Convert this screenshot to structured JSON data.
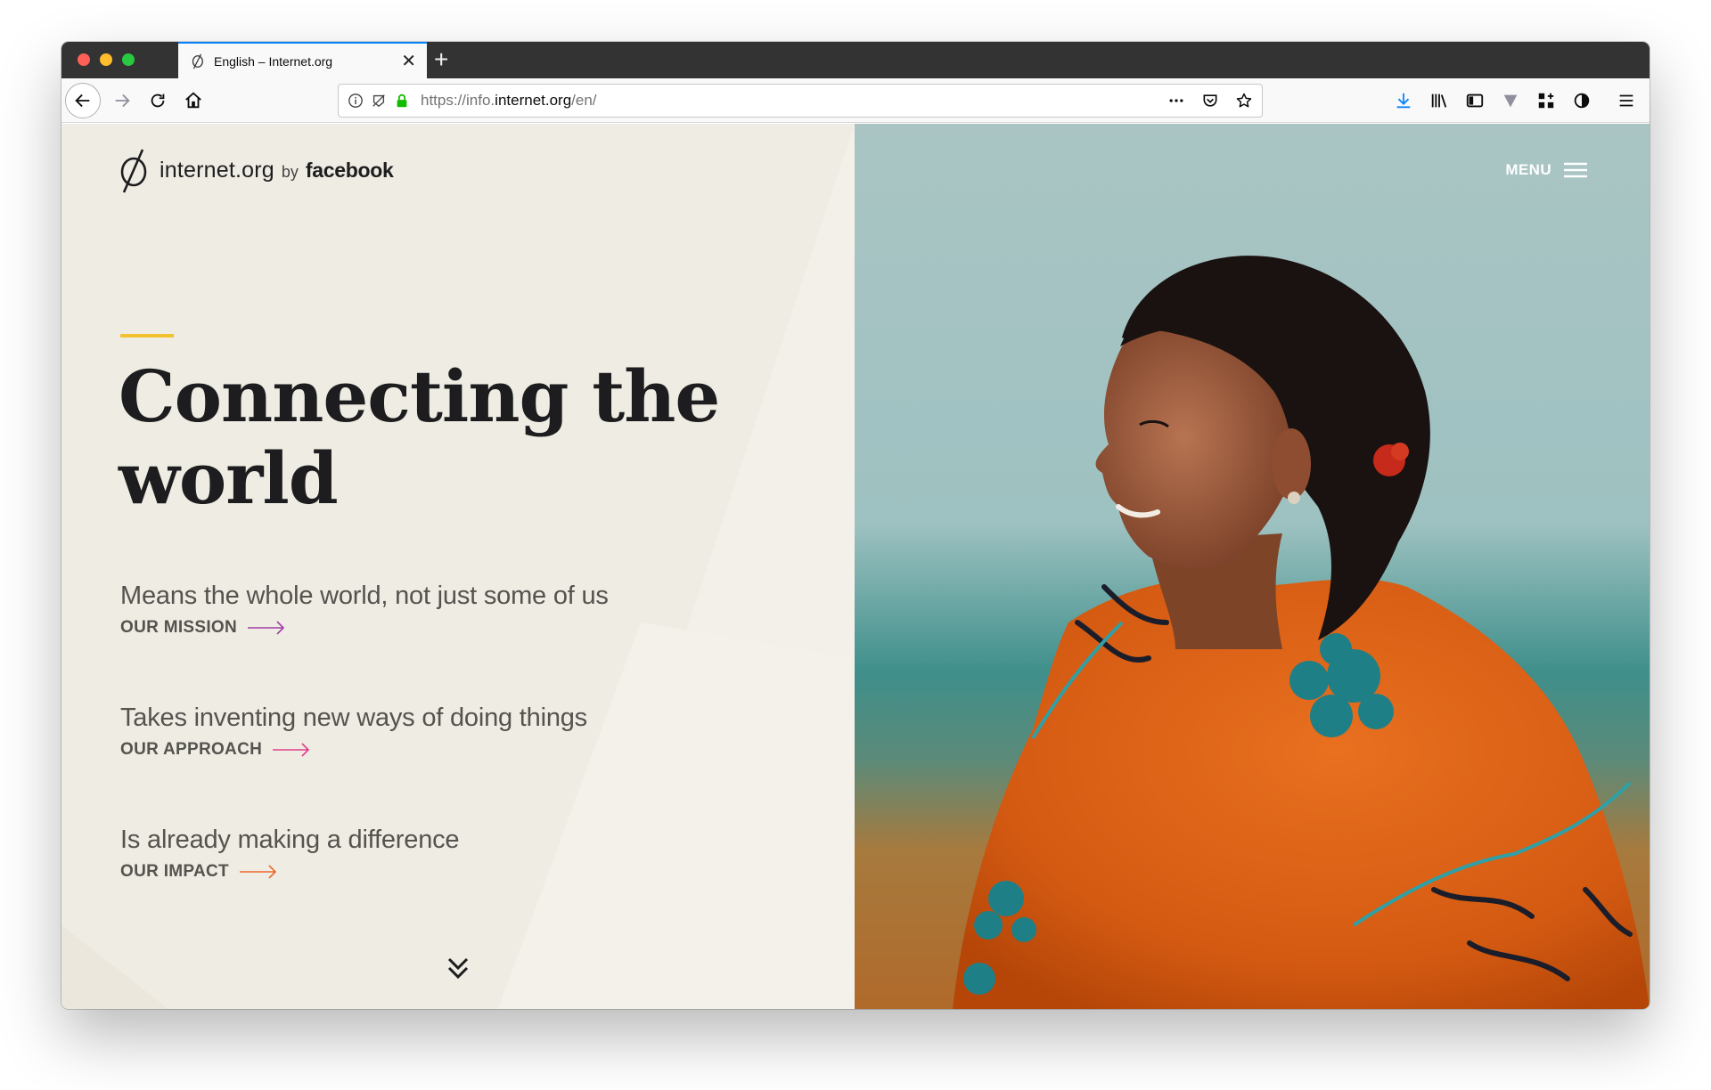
{
  "browser": {
    "tab": {
      "title": "English – Internet.org"
    },
    "new_tab_label": "+",
    "url": {
      "prefix": "https://info.",
      "domain": "internet.org",
      "path": "/en/"
    },
    "colors": {
      "tab_accent": "#0a84ff",
      "download_icon": "#0a84ff"
    }
  },
  "site": {
    "logo": {
      "name": "internet.org",
      "by": "by",
      "brand": "facebook"
    },
    "menu_label": "MENU",
    "accent_color": "#f2c231",
    "headline": "Connecting the world",
    "sections": [
      {
        "desc": "Means the whole world, not just some of us",
        "link": "OUR MISSION",
        "arrow_color": "#a23ea8"
      },
      {
        "desc": "Takes inventing new ways of doing things",
        "link": "OUR APPROACH",
        "arrow_color": "#e0408a"
      },
      {
        "desc": "Is already making a difference",
        "link": "OUR IMPACT",
        "arrow_color": "#ec6a2c"
      }
    ],
    "scroll_icon": "double-chevron-down-icon"
  }
}
